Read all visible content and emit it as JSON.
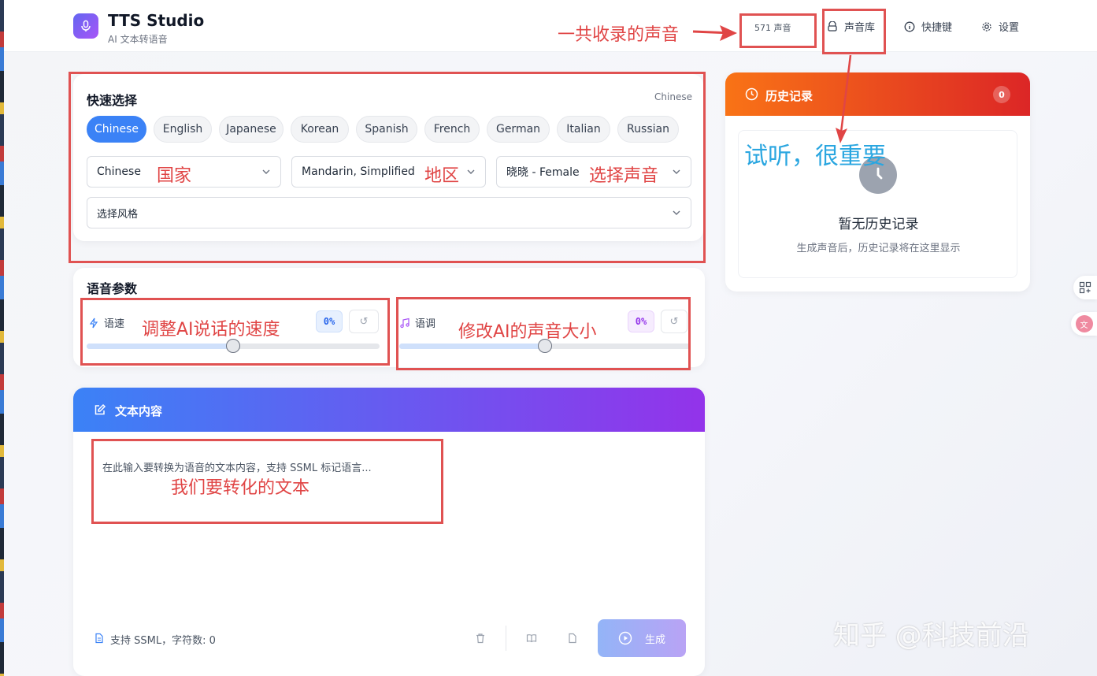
{
  "app": {
    "title": "TTS Studio",
    "subtitle": "AI 文本转语音"
  },
  "header": {
    "voice_count": "571 声音",
    "nav": [
      {
        "label": "声音库",
        "icon": "library-icon"
      },
      {
        "label": "快捷键",
        "icon": "info-icon"
      },
      {
        "label": "设置",
        "icon": "gear-icon"
      }
    ]
  },
  "quick_select": {
    "title": "快速选择",
    "current_language": "Chinese",
    "languages": [
      "Chinese",
      "English",
      "Japanese",
      "Korean",
      "Spanish",
      "French",
      "German",
      "Italian",
      "Russian"
    ],
    "active_language": "Chinese",
    "country_value": "Chinese",
    "region_value": "Mandarin, Simplified",
    "voice_value": "晓晓 - Female",
    "style_placeholder": "选择风格"
  },
  "params": {
    "title": "语音参数",
    "rate": {
      "label": "语速",
      "value_text": "0%",
      "value": 0,
      "reset": "↺"
    },
    "pitch": {
      "label": "语调",
      "value_text": "0%",
      "value": 0,
      "reset": "↺"
    }
  },
  "text_content": {
    "title": "文本内容",
    "placeholder": "在此输入要转换为语音的文本内容，支持 SSML 标记语言...",
    "footer_info": "支持 SSML，字符数: 0",
    "generate_label": "生成"
  },
  "history": {
    "title": "历史记录",
    "count": "0",
    "empty_title": "暂无历史记录",
    "empty_desc": "生成声音后，历史记录将在这里显示"
  },
  "annotations": {
    "voice_count_note": "一共收录的声音",
    "country": "国家",
    "region": "地区",
    "voice": "选择声音",
    "preview": "试听，很重要",
    "rate": "调整AI说话的速度",
    "pitch": "修改AI的声音大小",
    "text": "我们要转化的文本"
  },
  "watermark": "知乎 @科技前沿",
  "colors": {
    "primary": "#3b82f6",
    "annotation": "#e05252",
    "history_header_start": "#f97316",
    "history_header_end": "#dc2626",
    "text_header_start": "#3b82f6",
    "text_header_end": "#9333ea"
  }
}
